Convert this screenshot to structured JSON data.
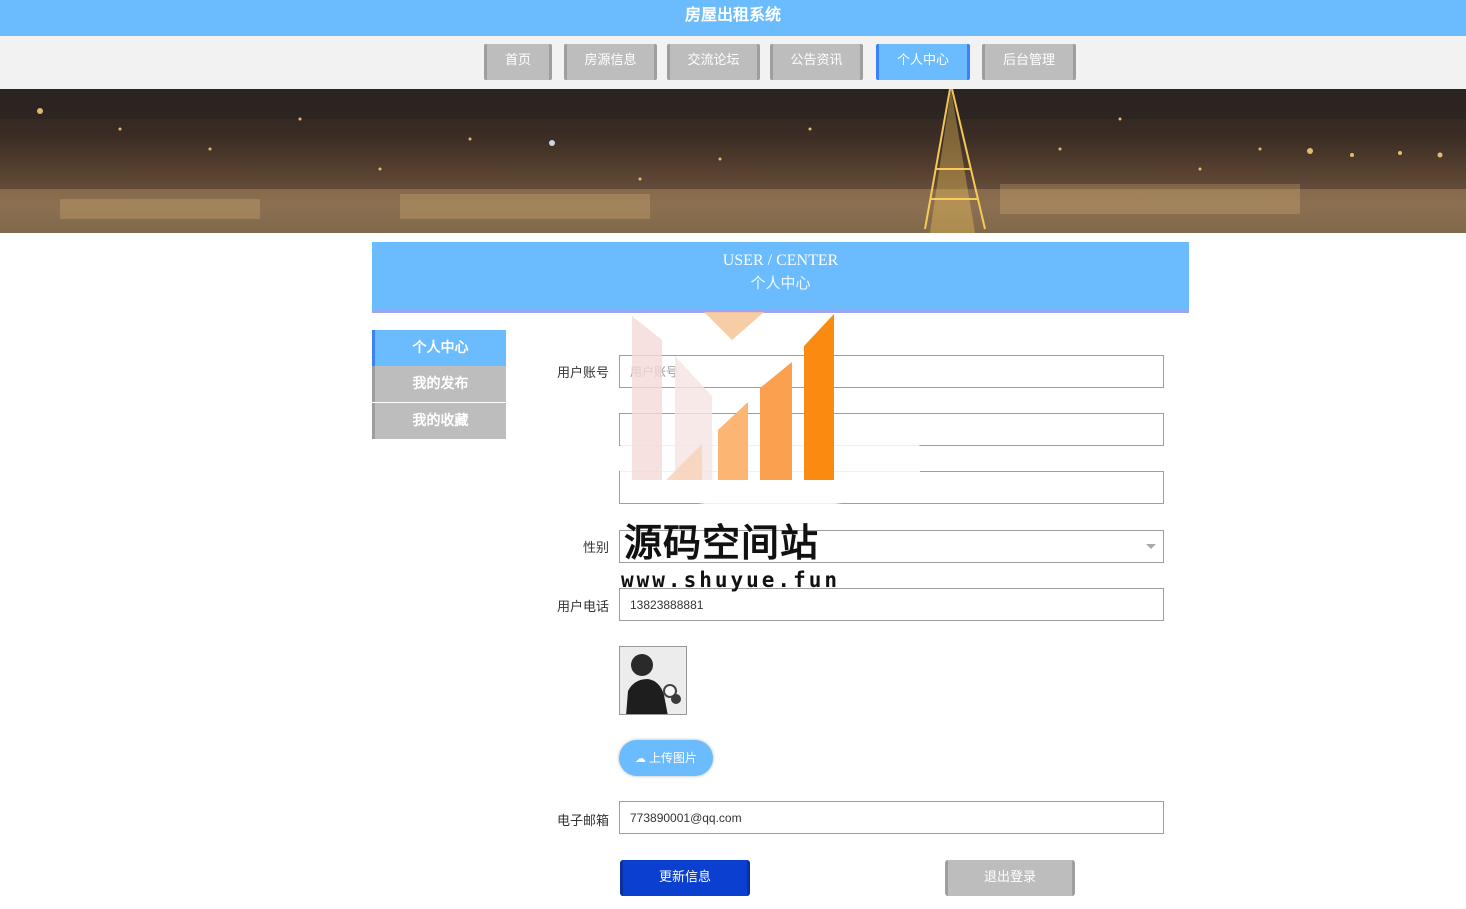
{
  "app": {
    "title": "房屋出租系统"
  },
  "nav": {
    "items": [
      {
        "label": "首页"
      },
      {
        "label": "房源信息"
      },
      {
        "label": "交流论坛"
      },
      {
        "label": "公告资讯"
      },
      {
        "label": "个人中心",
        "active": true
      },
      {
        "label": "后台管理"
      }
    ]
  },
  "section": {
    "title_en": "USER / CENTER",
    "title_cn": "个人中心"
  },
  "sidebar": {
    "items": [
      {
        "label": "个人中心",
        "active": true
      },
      {
        "label": "我的发布"
      },
      {
        "label": "我的收藏"
      }
    ]
  },
  "form": {
    "account": {
      "label": "用户账号",
      "placeholder": "用户账号"
    },
    "gender": {
      "label": "性别"
    },
    "phone": {
      "label": "用户电话",
      "value": "13823888881"
    },
    "upload": {
      "label": "上传图片"
    },
    "email": {
      "label": "电子邮箱",
      "value": "773890001@qq.com"
    }
  },
  "actions": {
    "update": "更新信息",
    "logout": "退出登录"
  },
  "watermark": {
    "title": "源码空间站",
    "url": "www.shuyue.fun"
  },
  "colors": {
    "accent": "#6bbcff",
    "primary_button": "#0a3fcf",
    "inactive": "#bdbdbd"
  }
}
